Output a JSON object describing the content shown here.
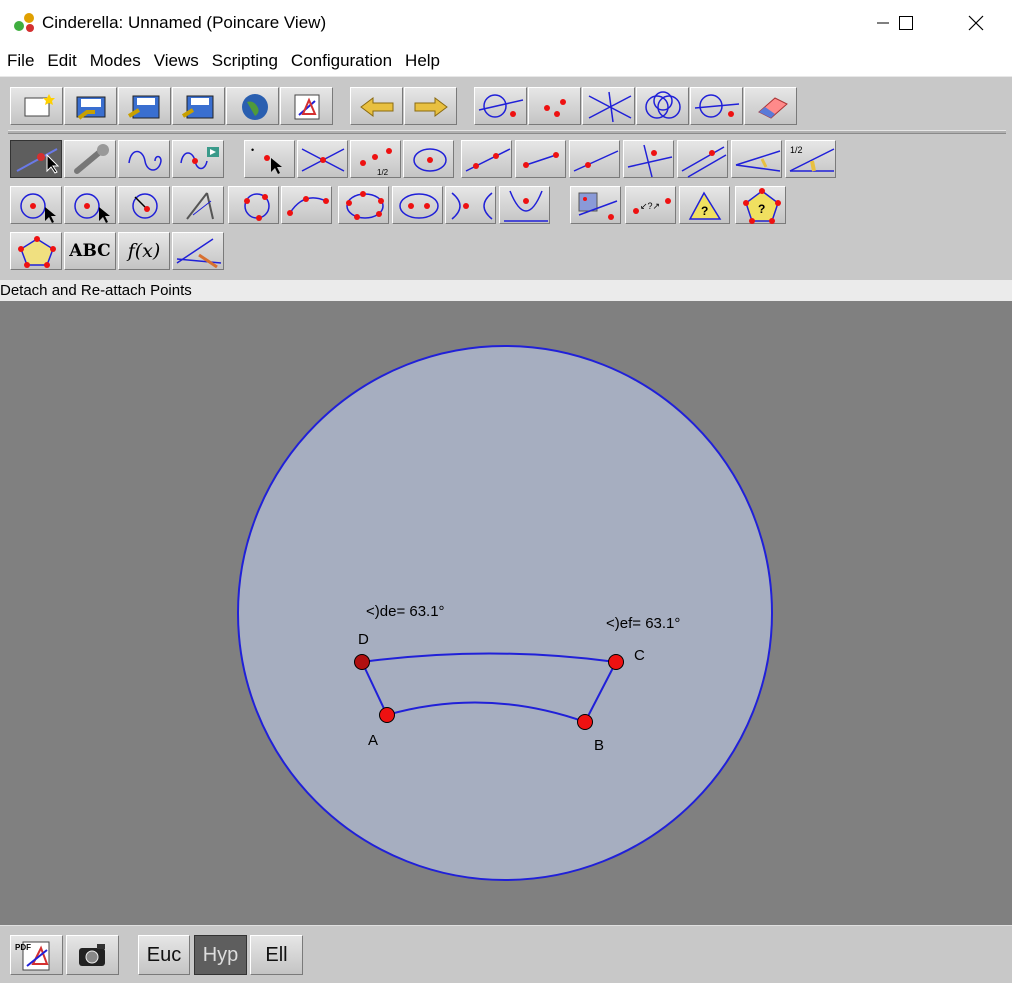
{
  "window": {
    "title": "Cinderella: Unnamed (Poincare View)"
  },
  "menu": [
    "File",
    "Edit",
    "Modes",
    "Views",
    "Scripting",
    "Configuration",
    "Help"
  ],
  "toolbar": {
    "file_tools": [
      "new-document",
      "open-file",
      "save-file",
      "save-as",
      "web-export",
      "print"
    ],
    "history_tools": [
      "undo-arrow",
      "redo-arrow"
    ],
    "edit_tools": [
      "select-line-icon",
      "select-points-icon",
      "select-all-icon",
      "select-circles-icon",
      "select-mixed-icon",
      "eraser-icon"
    ],
    "mode_row1": [
      "move-mode",
      "wrench-properties",
      "curve-mode",
      "animation-mode",
      "add-point",
      "intersection-point",
      "midpoint",
      "center-point",
      "line-through-points",
      "segment",
      "line",
      "perpendicular-line",
      "parallel-line",
      "angle-bisector",
      "measure-angle",
      "half-angle"
    ],
    "mode_row2": [
      "circle-by-radius",
      "circle-by-point",
      "compass-circle",
      "compass",
      "circle-three-points",
      "arc",
      "conic-five-points",
      "ellipse",
      "hyperbola",
      "parabola",
      "transform-tool",
      "distance-measure",
      "triangle-info",
      "polygon-info"
    ],
    "mode_row3": [
      "polygon",
      "text-tool",
      "function-tool",
      "angle-tool"
    ],
    "labels": {
      "text_tool": "ABC",
      "function_tool": "f(x)"
    }
  },
  "status": {
    "text": "Detach and Re-attach Points"
  },
  "construction": {
    "points": [
      {
        "name": "A"
      },
      {
        "name": "B"
      },
      {
        "name": "C"
      },
      {
        "name": "D"
      }
    ],
    "angle_labels": [
      "<)de= 63.1°",
      "<)ef= 63.1°"
    ],
    "colors": {
      "disk_fill": "#a6aec0",
      "boundary": "#2020d8",
      "point": "#ee1111",
      "background": "#808080"
    }
  },
  "geometry_buttons": [
    {
      "label": "Euc",
      "active": false
    },
    {
      "label": "Hyp",
      "active": true
    },
    {
      "label": "Ell",
      "active": false
    }
  ],
  "bottom_tools": [
    "pdf-export-icon",
    "camera-icon"
  ]
}
